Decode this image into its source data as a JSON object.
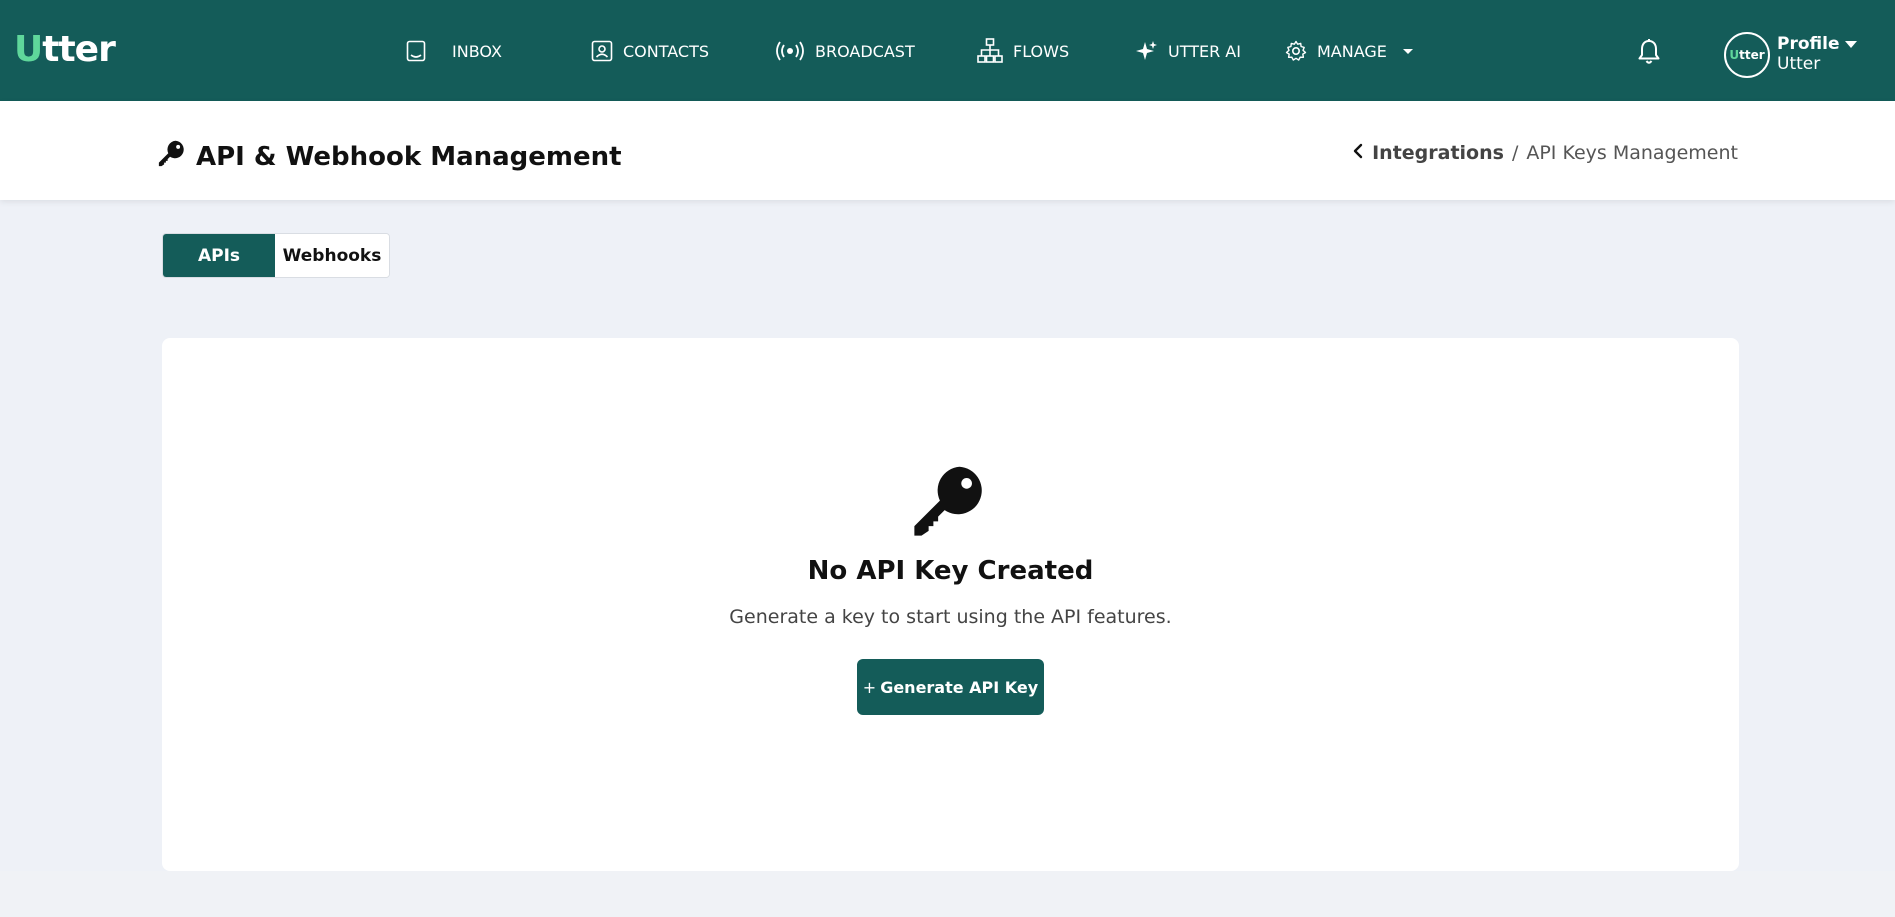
{
  "brand": {
    "logo_first": "U",
    "logo_rest": "tter",
    "primary_color": "#145c59",
    "accent_color": "#5fd79b"
  },
  "nav": {
    "items": [
      {
        "label": "INBOX",
        "icon": "inbox-icon"
      },
      {
        "label": "CONTACTS",
        "icon": "contact-card-icon"
      },
      {
        "label": "BROADCAST",
        "icon": "broadcast-icon"
      },
      {
        "label": "FLOWS",
        "icon": "flows-icon"
      },
      {
        "label": "UTTER AI",
        "icon": "sparkles-icon"
      },
      {
        "label": "MANAGE",
        "icon": "gear-icon"
      }
    ],
    "notifications_icon": "bell-icon"
  },
  "profile": {
    "avatar_first": "U",
    "avatar_rest": "tter",
    "title": "Profile",
    "subtitle": "Utter"
  },
  "header": {
    "title": "API & Webhook Management",
    "title_icon": "key-icon",
    "breadcrumb_link": "Integrations",
    "breadcrumb_separator": "/",
    "breadcrumb_current": "API Keys Management"
  },
  "tabs": [
    {
      "label": "APIs",
      "active": true
    },
    {
      "label": "Webhooks",
      "active": false
    }
  ],
  "empty_state": {
    "icon": "key-icon",
    "title": "No API Key Created",
    "subtitle": "Generate a key to start using the API features.",
    "button_plus": "+",
    "button_label": "Generate API Key"
  }
}
